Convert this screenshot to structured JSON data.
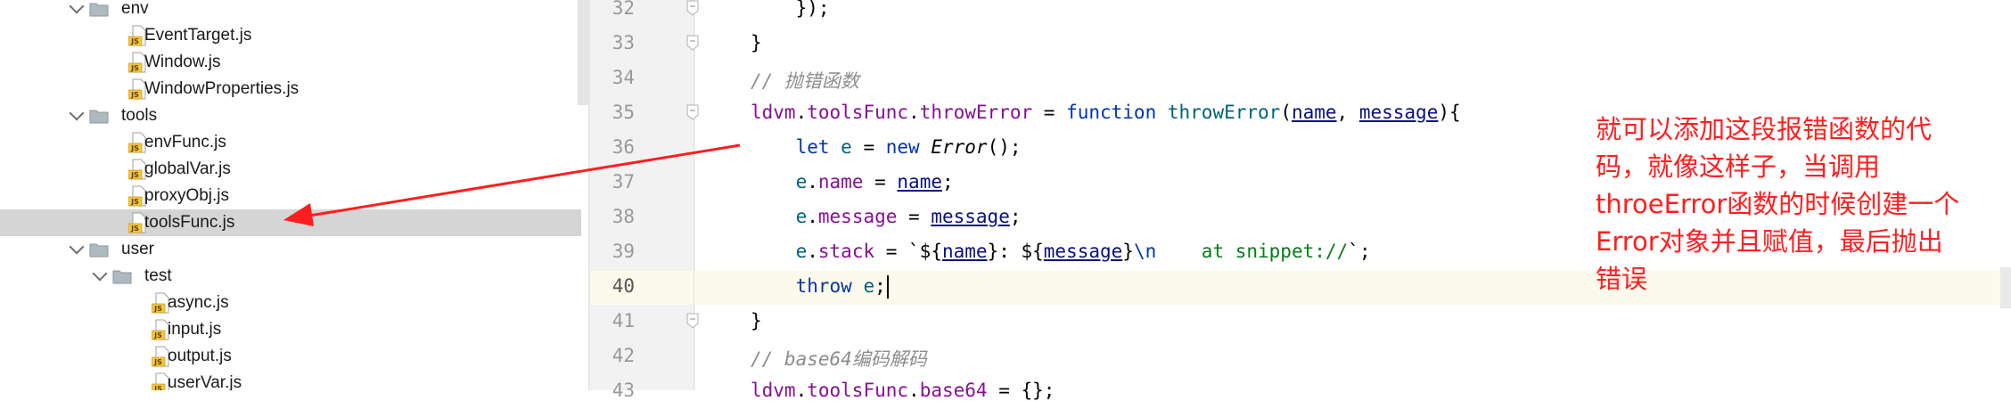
{
  "project_tree": {
    "rows": [
      {
        "label": "env",
        "kind": "folder",
        "expanded": true
      },
      {
        "label": "EventTarget.js",
        "kind": "file"
      },
      {
        "label": "Window.js",
        "kind": "file"
      },
      {
        "label": "WindowProperties.js",
        "kind": "file"
      },
      {
        "label": "tools",
        "kind": "folder",
        "expanded": true
      },
      {
        "label": "envFunc.js",
        "kind": "file"
      },
      {
        "label": "globalVar.js",
        "kind": "file"
      },
      {
        "label": "proxyObj.js",
        "kind": "file"
      },
      {
        "label": "toolsFunc.js",
        "kind": "file",
        "selected": true
      },
      {
        "label": "user",
        "kind": "folder",
        "expanded": true
      },
      {
        "label": "test",
        "kind": "folder",
        "expanded": true
      },
      {
        "label": "async.js",
        "kind": "file"
      },
      {
        "label": "input.js",
        "kind": "file"
      },
      {
        "label": "output.js",
        "kind": "file"
      },
      {
        "label": "userVar.js",
        "kind": "file"
      }
    ],
    "file_icon_badge": "JS"
  },
  "editor": {
    "line_numbers": [
      "32",
      "33",
      "34",
      "35",
      "36",
      "37",
      "38",
      "39",
      "40",
      "41",
      "42",
      "43"
    ],
    "current_line": "40",
    "lines": [
      [
        {
          "t": "    });",
          "c": "ident"
        }
      ],
      [
        {
          "t": "}",
          "c": "ident"
        }
      ],
      [
        {
          "t": "// 抛错函数",
          "c": "cmt"
        }
      ],
      [
        {
          "t": "ldvm",
          "c": "prop"
        },
        {
          "t": ".",
          "c": "ident"
        },
        {
          "t": "toolsFunc",
          "c": "prop"
        },
        {
          "t": ".",
          "c": "ident"
        },
        {
          "t": "throwError",
          "c": "prop"
        },
        {
          "t": " = ",
          "c": "ident"
        },
        {
          "t": "function",
          "c": "kw"
        },
        {
          "t": " ",
          "c": "ident"
        },
        {
          "t": "throwError",
          "c": "fn"
        },
        {
          "t": "(",
          "c": "ident"
        },
        {
          "t": "name",
          "c": "param"
        },
        {
          "t": ", ",
          "c": "ident"
        },
        {
          "t": "message",
          "c": "param"
        },
        {
          "t": "){",
          "c": "ident"
        }
      ],
      [
        {
          "t": "    ",
          "c": "ident"
        },
        {
          "t": "let",
          "c": "kw"
        },
        {
          "t": " ",
          "c": "ident"
        },
        {
          "t": "e",
          "c": "fn"
        },
        {
          "t": " = ",
          "c": "ident"
        },
        {
          "t": "new",
          "c": "kw"
        },
        {
          "t": " ",
          "c": "ident"
        },
        {
          "t": "Error",
          "c": "ident italic"
        },
        {
          "t": "();",
          "c": "ident"
        }
      ],
      [
        {
          "t": "    ",
          "c": "ident"
        },
        {
          "t": "e",
          "c": "fn"
        },
        {
          "t": ".",
          "c": "ident"
        },
        {
          "t": "name",
          "c": "prop"
        },
        {
          "t": " = ",
          "c": "ident"
        },
        {
          "t": "name",
          "c": "param"
        },
        {
          "t": ";",
          "c": "ident"
        }
      ],
      [
        {
          "t": "    ",
          "c": "ident"
        },
        {
          "t": "e",
          "c": "fn"
        },
        {
          "t": ".",
          "c": "ident"
        },
        {
          "t": "message",
          "c": "prop"
        },
        {
          "t": " = ",
          "c": "ident"
        },
        {
          "t": "message",
          "c": "param"
        },
        {
          "t": ";",
          "c": "ident"
        }
      ],
      [
        {
          "t": "    ",
          "c": "ident"
        },
        {
          "t": "e",
          "c": "fn"
        },
        {
          "t": ".",
          "c": "ident"
        },
        {
          "t": "stack",
          "c": "prop"
        },
        {
          "t": " = `${",
          "c": "ident"
        },
        {
          "t": "name",
          "c": "param"
        },
        {
          "t": "}: ${",
          "c": "ident"
        },
        {
          "t": "message",
          "c": "param"
        },
        {
          "t": "}",
          "c": "ident"
        },
        {
          "t": "\\n",
          "c": "esc"
        },
        {
          "t": "    at snippet://",
          "c": "green"
        },
        {
          "t": "`;",
          "c": "ident"
        }
      ],
      [
        {
          "t": "    ",
          "c": "ident"
        },
        {
          "t": "throw",
          "c": "kw"
        },
        {
          "t": " ",
          "c": "ident"
        },
        {
          "t": "e",
          "c": "fn"
        },
        {
          "t": ";",
          "c": "ident"
        }
      ],
      [
        {
          "t": "}",
          "c": "ident"
        }
      ],
      [
        {
          "t": "// base64编码解码",
          "c": "cmt"
        }
      ],
      [
        {
          "t": "ldvm",
          "c": "prop"
        },
        {
          "t": ".",
          "c": "ident"
        },
        {
          "t": "toolsFunc",
          "c": "prop"
        },
        {
          "t": ".",
          "c": "ident"
        },
        {
          "t": "base64",
          "c": "prop"
        },
        {
          "t": " = {};",
          "c": "ident"
        }
      ]
    ],
    "fold_marker_lines": [
      "32",
      "33",
      "35",
      "41"
    ]
  },
  "annotation": {
    "lines": [
      "就可以添加这段报错函数的代",
      "码，就像这样子，当调用",
      "throeError函数的时候创建一个",
      "Error对象并且赋值，最后抛出",
      "错误"
    ],
    "color": "#ff1e1e"
  },
  "colors": {
    "keyword": "#0033b3",
    "property": "#871094",
    "function": "#00627a",
    "comment": "#8c8c8c",
    "string": "#067d17",
    "selection": "#d5d5d5",
    "current_line": "#fcfaed"
  }
}
